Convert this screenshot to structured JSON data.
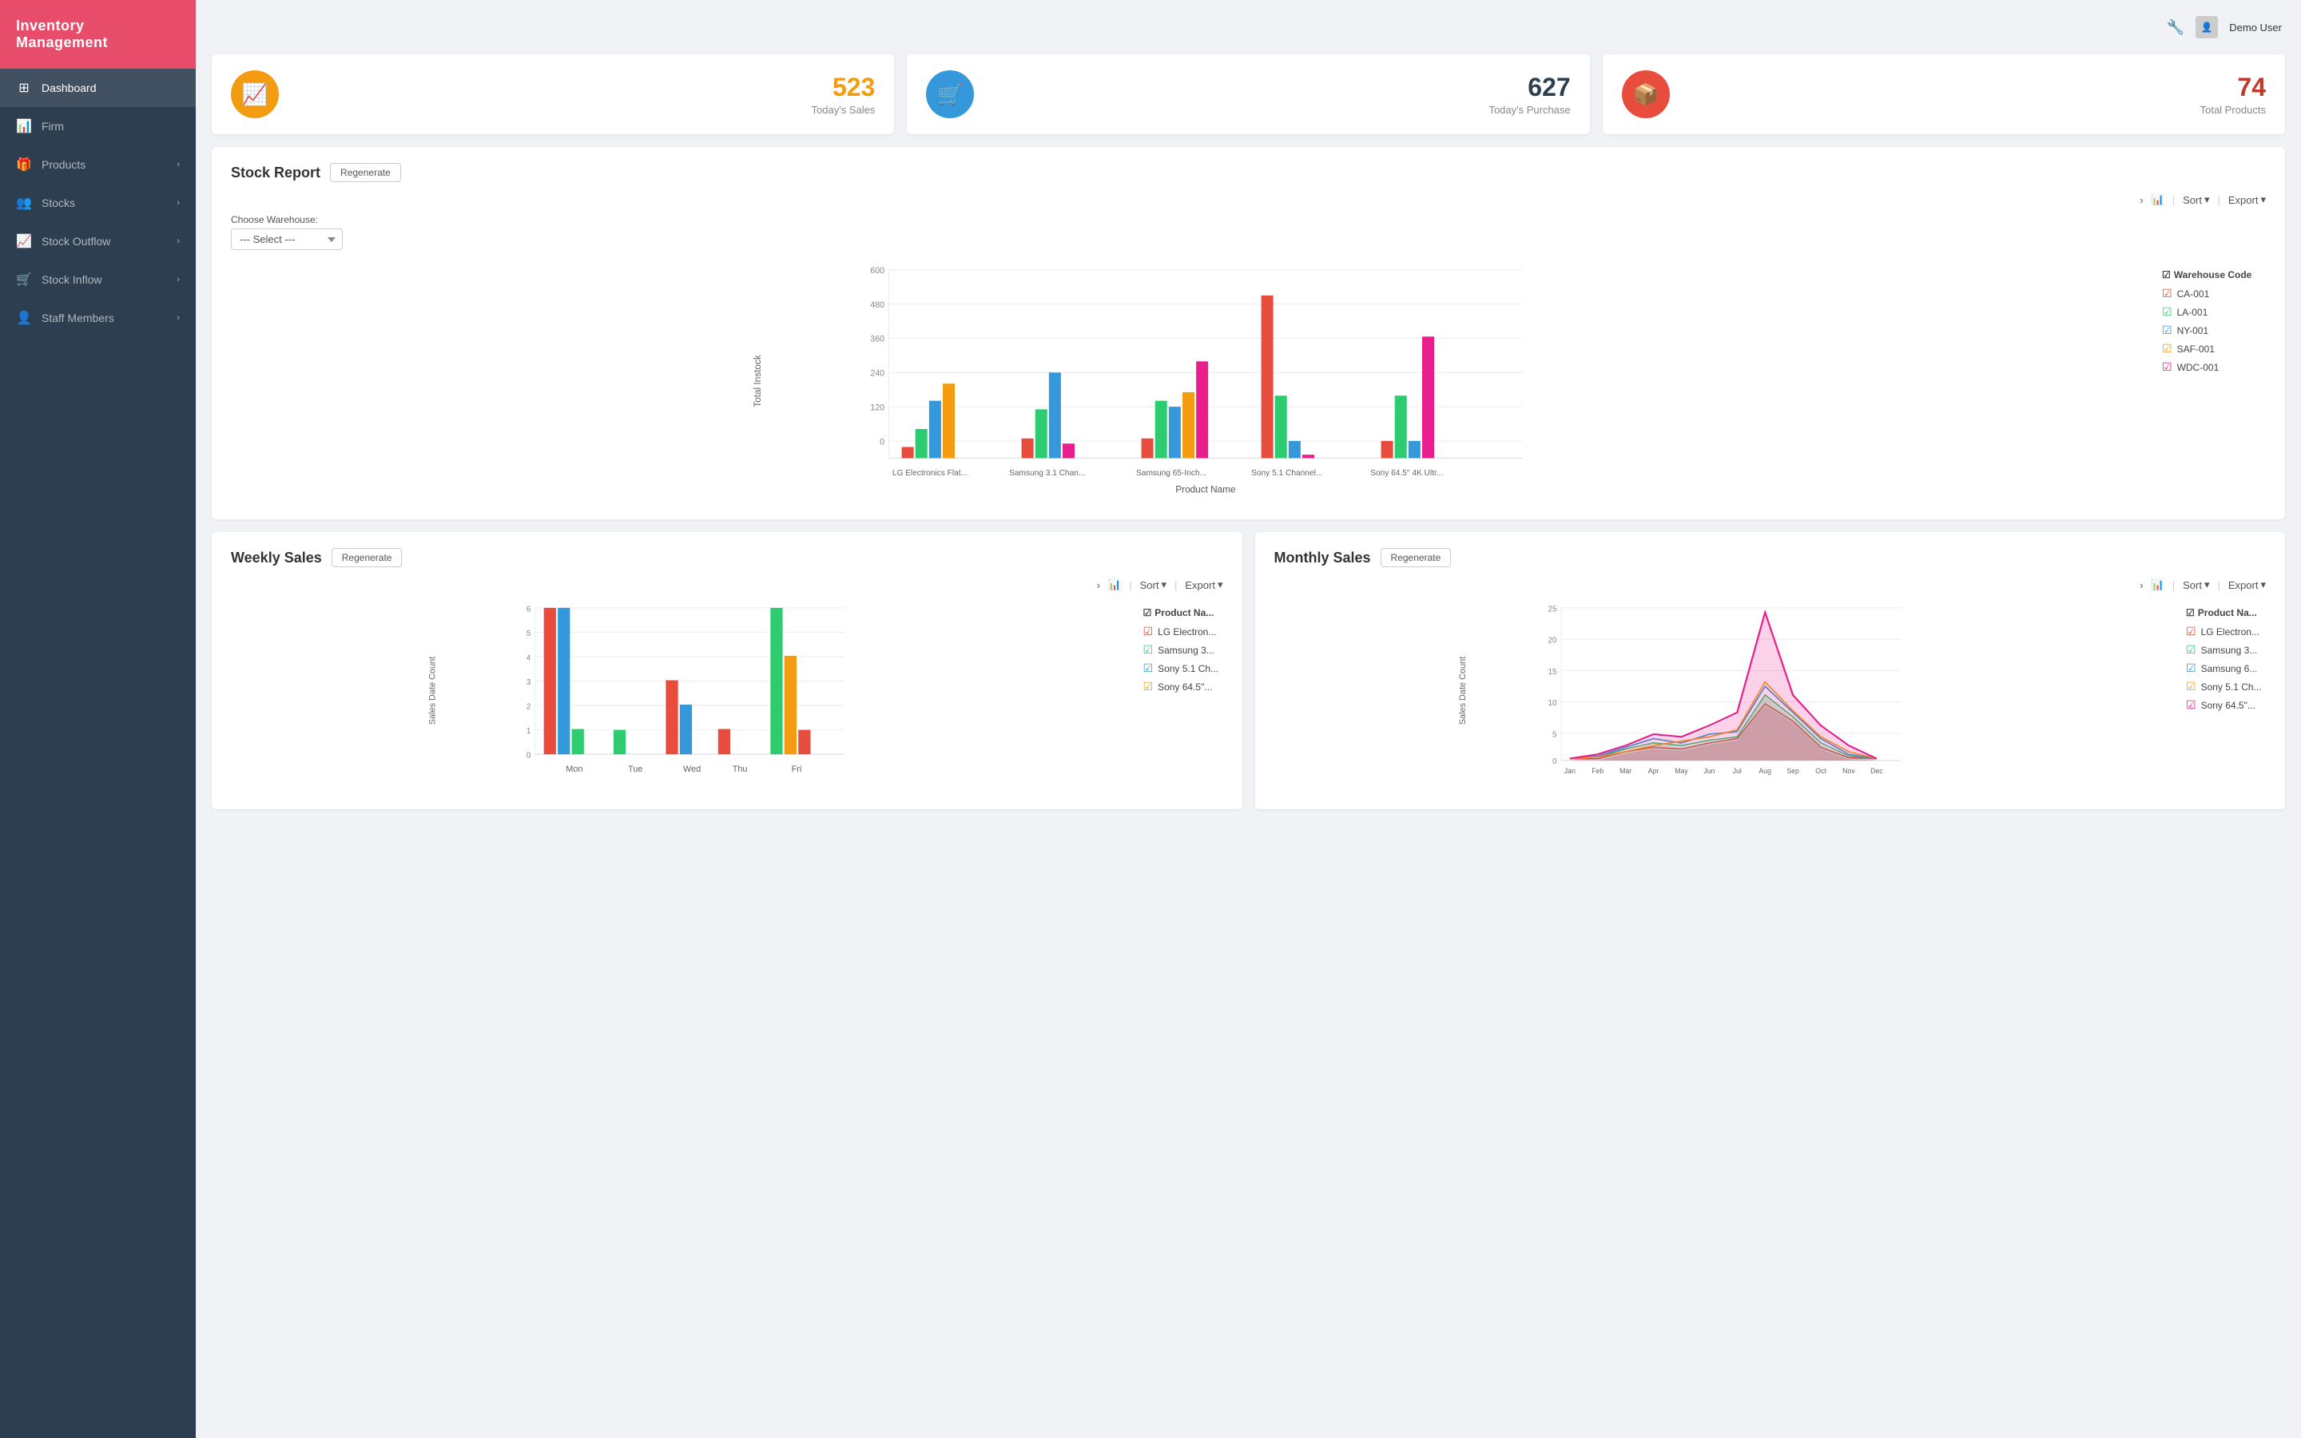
{
  "app": {
    "title": "Inventory Management"
  },
  "topbar": {
    "user": "Demo User"
  },
  "sidebar": {
    "items": [
      {
        "id": "dashboard",
        "label": "Dashboard",
        "icon": "⊞",
        "active": true,
        "hasArrow": false
      },
      {
        "id": "firm",
        "label": "Firm",
        "icon": "📊",
        "active": false,
        "hasArrow": false
      },
      {
        "id": "products",
        "label": "Products",
        "icon": "🎁",
        "active": false,
        "hasArrow": true
      },
      {
        "id": "stocks",
        "label": "Stocks",
        "icon": "👥",
        "active": false,
        "hasArrow": true
      },
      {
        "id": "stock-outflow",
        "label": "Stock Outflow",
        "icon": "📈",
        "active": false,
        "hasArrow": true
      },
      {
        "id": "stock-inflow",
        "label": "Stock Inflow",
        "icon": "🛒",
        "active": false,
        "hasArrow": true
      },
      {
        "id": "staff-members",
        "label": "Staff Members",
        "icon": "👤",
        "active": false,
        "hasArrow": true
      }
    ]
  },
  "kpis": [
    {
      "id": "sales",
      "icon": "📈",
      "iconClass": "gold",
      "number": "523",
      "numberClass": "gold",
      "label": "Today's Sales"
    },
    {
      "id": "purchase",
      "icon": "🛒",
      "iconClass": "blue",
      "number": "627",
      "numberClass": "blue",
      "label": "Today's Purchase"
    },
    {
      "id": "products",
      "icon": "📦",
      "iconClass": "red",
      "number": "74",
      "numberClass": "red",
      "label": "Total Products"
    }
  ],
  "stock_report": {
    "title": "Stock Report",
    "regenerate_label": "Regenerate",
    "warehouse_label": "Choose Warehouse:",
    "warehouse_placeholder": "--- Select ---",
    "warehouse_options": [
      "--- Select ---",
      "CA-001",
      "LA-001",
      "NY-001",
      "SAF-001",
      "WDC-001"
    ],
    "sort_label": "Sort",
    "export_label": "Export",
    "legend": {
      "title": "Warehouse Code",
      "items": [
        {
          "label": "CA-001",
          "color": "#e74c3c"
        },
        {
          "label": "LA-001",
          "color": "#2ecc71"
        },
        {
          "label": "NY-001",
          "color": "#3498db"
        },
        {
          "label": "SAF-001",
          "color": "#f39c12"
        },
        {
          "label": "WDC-001",
          "color": "#e91e8c"
        }
      ]
    },
    "y_axis_labels": [
      "600",
      "480",
      "360",
      "240",
      "120",
      "0"
    ],
    "x_axis_labels": [
      "LG Electronics Flat...",
      "Samsung 3.1 Chan...",
      "Samsung 65-Inch...",
      "Sony 5.1 Channel...",
      "Sony 64.5\" 4K Ultr..."
    ],
    "x_label": "Product Name",
    "y_label": "Total Instock"
  },
  "weekly_sales": {
    "title": "Weekly Sales",
    "regenerate_label": "Regenerate",
    "sort_label": "Sort",
    "export_label": "Export",
    "legend": {
      "title": "Product Na...",
      "items": [
        {
          "label": "LG Electron...",
          "color": "#e74c3c"
        },
        {
          "label": "Samsung 3...",
          "color": "#2ecc71"
        },
        {
          "label": "Sony 5.1 Ch...",
          "color": "#3498db"
        },
        {
          "label": "Sony 64.5\"...",
          "color": "#f39c12"
        }
      ]
    },
    "x_labels": [
      "Mon",
      "Tue",
      "Wed",
      "Thu",
      "Fri"
    ],
    "y_labels": [
      "6",
      "5",
      "4",
      "3",
      "2",
      "1",
      "0"
    ],
    "y_label": "Sales Date Count"
  },
  "monthly_sales": {
    "title": "Monthly Sales",
    "regenerate_label": "Regenerate",
    "sort_label": "Sort",
    "export_label": "Export",
    "legend": {
      "title": "Product Na...",
      "items": [
        {
          "label": "LG Electron...",
          "color": "#e74c3c"
        },
        {
          "label": "Samsung 3...",
          "color": "#2ecc71"
        },
        {
          "label": "Samsung 6...",
          "color": "#3498db"
        },
        {
          "label": "Sony 5.1 Ch...",
          "color": "#f39c12"
        },
        {
          "label": "Sony 64.5\"...",
          "color": "#e91e8c"
        }
      ]
    },
    "x_labels": [
      "Jan",
      "Feb",
      "Mar",
      "Apr",
      "May",
      "Jun",
      "Jul",
      "Aug",
      "Sep",
      "Oct",
      "Nov",
      "Dec"
    ],
    "y_labels": [
      "25",
      "20",
      "15",
      "10",
      "5",
      "0"
    ],
    "y_label": "Sales Date Count"
  }
}
